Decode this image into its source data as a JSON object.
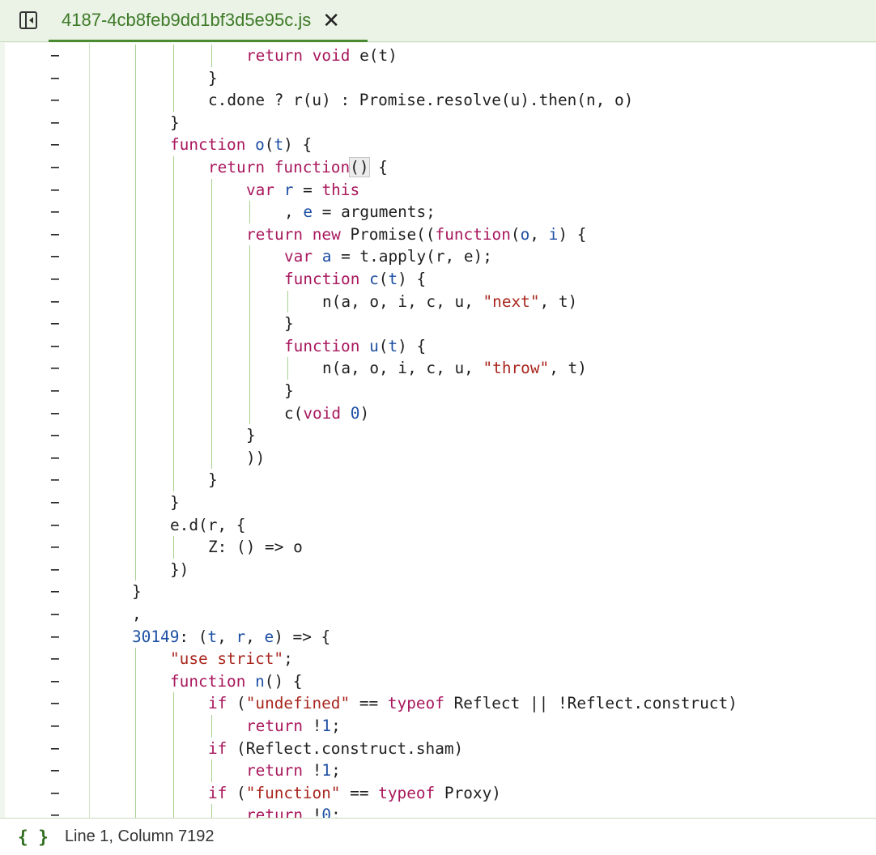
{
  "tab": {
    "filename": "4187-4cb8feb9dd1bf3d5e95c.js",
    "close_glyph": "✕"
  },
  "sidebar_toggle_icon": "panel-left-collapse-icon",
  "gutter_marker": "−",
  "code_lines": [
    [
      12,
      [
        [
          "kw",
          "return"
        ],
        [
          "p",
          " "
        ],
        [
          "kw",
          "void"
        ],
        [
          "p",
          " e(t)"
        ]
      ]
    ],
    [
      11,
      [
        [
          "p",
          "}"
        ]
      ]
    ],
    [
      11,
      [
        [
          "p",
          "c.done ? r(u) : Promise.resolve(u).then(n, o)"
        ]
      ]
    ],
    [
      10,
      [
        [
          "p",
          "}"
        ]
      ]
    ],
    [
      10,
      [
        [
          "kw",
          "function"
        ],
        [
          "p",
          " "
        ],
        [
          "id",
          "o"
        ],
        [
          "p",
          "("
        ],
        [
          "id",
          "t"
        ],
        [
          "p",
          ") {"
        ]
      ]
    ],
    [
      11,
      [
        [
          "kw",
          "return"
        ],
        [
          "p",
          " "
        ],
        [
          "kw",
          "function"
        ],
        [
          "hl",
          "()"
        ],
        [
          "p",
          " {"
        ]
      ]
    ],
    [
      12,
      [
        [
          "kw",
          "var"
        ],
        [
          "p",
          " "
        ],
        [
          "id",
          "r"
        ],
        [
          "p",
          " = "
        ],
        [
          "kw",
          "this"
        ]
      ]
    ],
    [
      13,
      [
        [
          "p",
          ", "
        ],
        [
          "id",
          "e"
        ],
        [
          "p",
          " = arguments;"
        ]
      ]
    ],
    [
      12,
      [
        [
          "kw",
          "return"
        ],
        [
          "p",
          " "
        ],
        [
          "kw",
          "new"
        ],
        [
          "p",
          " Promise(("
        ],
        [
          "kw",
          "function"
        ],
        [
          "p",
          "("
        ],
        [
          "id",
          "o"
        ],
        [
          "p",
          ", "
        ],
        [
          "id",
          "i"
        ],
        [
          "p",
          ") {"
        ]
      ]
    ],
    [
      13,
      [
        [
          "kw",
          "var"
        ],
        [
          "p",
          " "
        ],
        [
          "id",
          "a"
        ],
        [
          "p",
          " = t.apply(r, e);"
        ]
      ]
    ],
    [
      13,
      [
        [
          "kw",
          "function"
        ],
        [
          "p",
          " "
        ],
        [
          "id",
          "c"
        ],
        [
          "p",
          "("
        ],
        [
          "id",
          "t"
        ],
        [
          "p",
          ") {"
        ]
      ]
    ],
    [
      14,
      [
        [
          "p",
          "n(a, o, i, c, u, "
        ],
        [
          "str",
          "\"next\""
        ],
        [
          "p",
          ", t)"
        ]
      ]
    ],
    [
      13,
      [
        [
          "p",
          "}"
        ]
      ]
    ],
    [
      13,
      [
        [
          "kw",
          "function"
        ],
        [
          "p",
          " "
        ],
        [
          "id",
          "u"
        ],
        [
          "p",
          "("
        ],
        [
          "id",
          "t"
        ],
        [
          "p",
          ") {"
        ]
      ]
    ],
    [
      14,
      [
        [
          "p",
          "n(a, o, i, c, u, "
        ],
        [
          "str",
          "\"throw\""
        ],
        [
          "p",
          ", t)"
        ]
      ]
    ],
    [
      13,
      [
        [
          "p",
          "}"
        ]
      ]
    ],
    [
      13,
      [
        [
          "p",
          "c("
        ],
        [
          "kw",
          "void"
        ],
        [
          "p",
          " "
        ],
        [
          "num",
          "0"
        ],
        [
          "p",
          ")"
        ]
      ]
    ],
    [
      12,
      [
        [
          "p",
          "}"
        ]
      ]
    ],
    [
      12,
      [
        [
          "p",
          "))"
        ]
      ]
    ],
    [
      11,
      [
        [
          "p",
          "}"
        ]
      ]
    ],
    [
      10,
      [
        [
          "p",
          "}"
        ]
      ]
    ],
    [
      10,
      [
        [
          "p",
          "e.d(r, {"
        ]
      ]
    ],
    [
      11,
      [
        [
          "p",
          "Z: () => o"
        ]
      ]
    ],
    [
      10,
      [
        [
          "p",
          "})"
        ]
      ]
    ],
    [
      9,
      [
        [
          "p",
          "}"
        ]
      ]
    ],
    [
      9,
      [
        [
          "p",
          ","
        ]
      ]
    ],
    [
      9,
      [
        [
          "num",
          "30149"
        ],
        [
          "p",
          ": ("
        ],
        [
          "id",
          "t"
        ],
        [
          "p",
          ", "
        ],
        [
          "id",
          "r"
        ],
        [
          "p",
          ", "
        ],
        [
          "id",
          "e"
        ],
        [
          "p",
          ") => {"
        ]
      ]
    ],
    [
      10,
      [
        [
          "str",
          "\"use strict\""
        ],
        [
          "p",
          ";"
        ]
      ]
    ],
    [
      10,
      [
        [
          "kw",
          "function"
        ],
        [
          "p",
          " "
        ],
        [
          "id",
          "n"
        ],
        [
          "p",
          "() {"
        ]
      ]
    ],
    [
      11,
      [
        [
          "kw",
          "if"
        ],
        [
          "p",
          " ("
        ],
        [
          "str",
          "\"undefined\""
        ],
        [
          "p",
          " == "
        ],
        [
          "kw",
          "typeof"
        ],
        [
          "p",
          " Reflect || !Reflect.construct)"
        ]
      ]
    ],
    [
      12,
      [
        [
          "kw",
          "return"
        ],
        [
          "p",
          " !"
        ],
        [
          "num",
          "1"
        ],
        [
          "p",
          ";"
        ]
      ]
    ],
    [
      11,
      [
        [
          "kw",
          "if"
        ],
        [
          "p",
          " (Reflect.construct.sham)"
        ]
      ]
    ],
    [
      12,
      [
        [
          "kw",
          "return"
        ],
        [
          "p",
          " !"
        ],
        [
          "num",
          "1"
        ],
        [
          "p",
          ";"
        ]
      ]
    ],
    [
      11,
      [
        [
          "kw",
          "if"
        ],
        [
          "p",
          " ("
        ],
        [
          "str",
          "\"function\""
        ],
        [
          "p",
          " == "
        ],
        [
          "kw",
          "typeof"
        ],
        [
          "p",
          " Proxy)"
        ]
      ]
    ],
    [
      12,
      [
        [
          "kw",
          "return"
        ],
        [
          "p",
          " !"
        ],
        [
          "num",
          "0"
        ],
        [
          "p",
          ";"
        ]
      ]
    ]
  ],
  "status": {
    "icon": "{ }",
    "position_text": "Line 1, Column 7192"
  }
}
